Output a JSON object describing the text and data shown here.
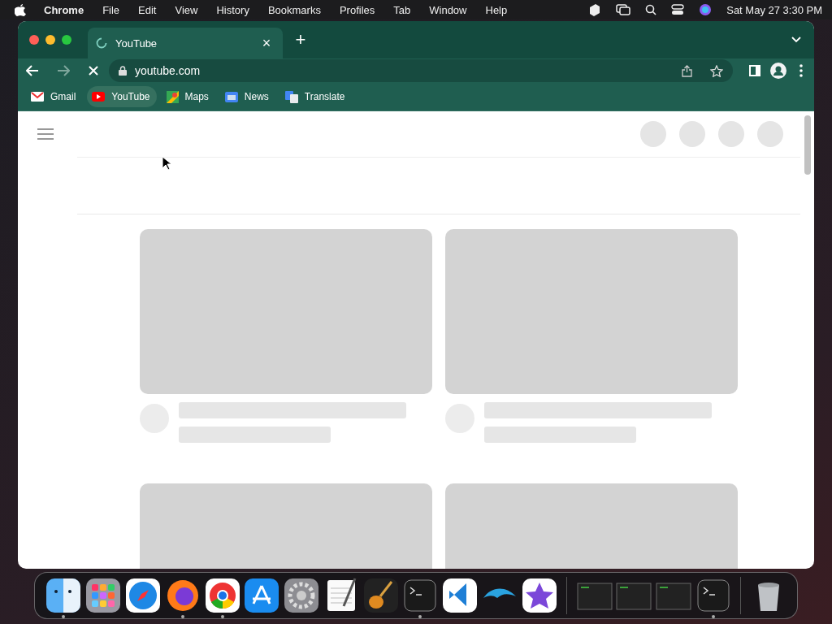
{
  "menu_bar": {
    "app": "Chrome",
    "items": [
      "File",
      "Edit",
      "View",
      "History",
      "Bookmarks",
      "Profiles",
      "Tab",
      "Window",
      "Help"
    ],
    "clock": "Sat May 27  3:30 PM"
  },
  "tabs": [
    {
      "title": "YouTube",
      "selected": true,
      "loading": true,
      "close": "×"
    }
  ],
  "new_tab": "+",
  "toolbar": {
    "address": "youtube.com",
    "loading": true
  },
  "bookmarks": [
    {
      "label": "Gmail",
      "kind": "mail",
      "selected": false
    },
    {
      "label": "YouTube",
      "kind": "video",
      "selected": true
    },
    {
      "label": "Maps",
      "kind": "map",
      "selected": false
    },
    {
      "label": "News",
      "kind": "news",
      "selected": false
    },
    {
      "label": "Translate",
      "kind": "translate",
      "selected": false
    }
  ],
  "feed": {
    "loading": true
  },
  "dock": [
    {
      "kind": "finder",
      "running": true
    },
    {
      "kind": "launchpad",
      "running": false
    },
    {
      "kind": "compass",
      "running": false
    },
    {
      "kind": "firefox",
      "running": true
    },
    {
      "kind": "chrome",
      "running": true
    },
    {
      "kind": "appstore",
      "running": false
    },
    {
      "kind": "settings",
      "running": false
    },
    {
      "kind": "notes",
      "running": false
    },
    {
      "kind": "guitar",
      "running": false
    },
    {
      "kind": "terminal",
      "running": true
    },
    {
      "kind": "code",
      "running": false
    },
    {
      "kind": "dolphin",
      "running": false
    },
    {
      "kind": "star",
      "running": false
    },
    {
      "kind": "divider"
    },
    {
      "kind": "window",
      "running": false
    },
    {
      "kind": "window",
      "running": false
    },
    {
      "kind": "window",
      "running": false
    },
    {
      "kind": "terminal",
      "running": true
    },
    {
      "kind": "divider"
    },
    {
      "kind": "trash",
      "running": false
    }
  ]
}
